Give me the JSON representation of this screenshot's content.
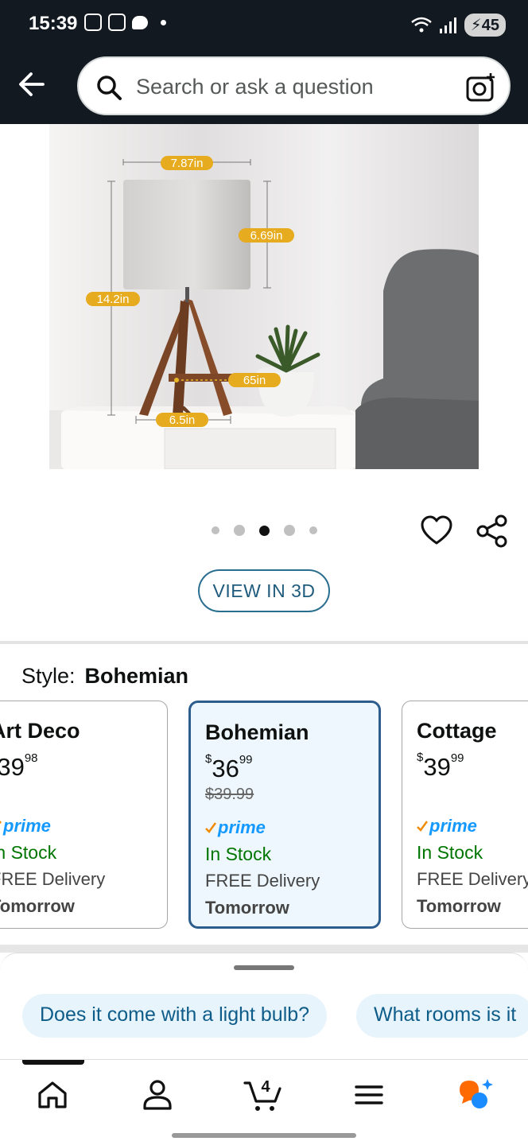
{
  "status_bar": {
    "time": "15:39",
    "battery": "45"
  },
  "search": {
    "placeholder": "Search or ask a question"
  },
  "image": {
    "labels": [
      "7.87in",
      "6.69in",
      "14.2in",
      "65in",
      "6.5in"
    ]
  },
  "carousel": {
    "count": 5,
    "active_index": 2
  },
  "buttons": {
    "view_3d": "VIEW IN 3D"
  },
  "style": {
    "label": "Style:",
    "value": "Bohemian"
  },
  "variants": [
    {
      "name": "Art Deco",
      "currency": "$",
      "price_whole": "39",
      "price_fraction": "98",
      "list_price": "",
      "prime": "prime",
      "stock": "In Stock",
      "delivery": "FREE Delivery",
      "when": "Tomorrow"
    },
    {
      "name": "Bohemian",
      "currency": "$",
      "price_whole": "36",
      "price_fraction": "99",
      "list_price": "$39.99",
      "prime": "prime",
      "stock": "In Stock",
      "delivery": "FREE Delivery",
      "when": "Tomorrow"
    },
    {
      "name": "Cottage",
      "currency": "$",
      "price_whole": "39",
      "price_fraction": "99",
      "list_price": "",
      "prime": "prime",
      "stock": "In Stock",
      "delivery": "FREE Delivery",
      "when": "Tomorrow"
    }
  ],
  "questions": [
    "Does it come with a light bulb?",
    "What rooms is it"
  ],
  "nav": {
    "cart_count": "4"
  },
  "colors": {
    "header": "#131921",
    "prime_blue": "#1399ff",
    "stock_green": "#007600",
    "link_blue": "#0e5c89",
    "rufus_orange": "#ff6a00"
  }
}
